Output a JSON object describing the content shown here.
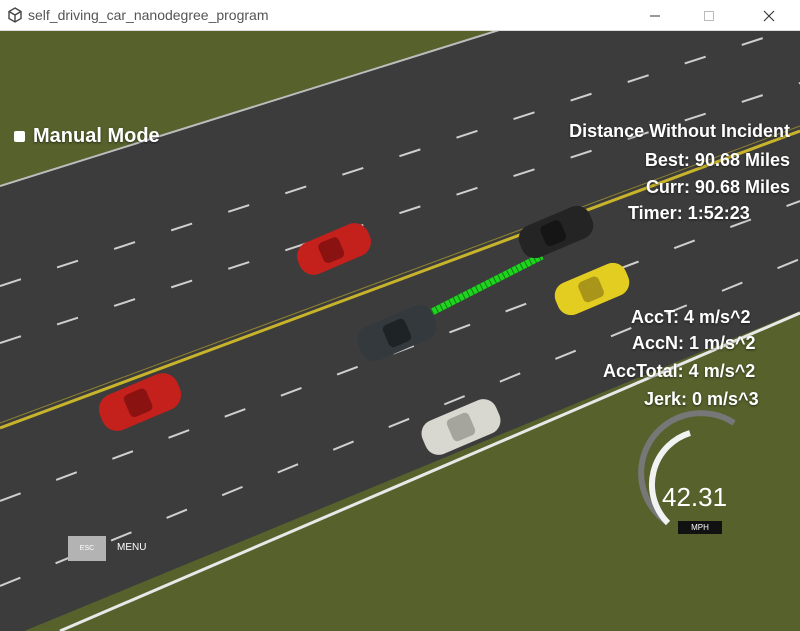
{
  "window": {
    "title": "self_driving_car_nanodegree_program",
    "min_icon": "minimize-icon",
    "max_icon": "maximize-icon",
    "close_icon": "close-icon"
  },
  "hud": {
    "manual_mode_label": "Manual Mode",
    "distance_title": "Distance Without Incident",
    "best": "Best: 90.68 Miles",
    "curr": "Curr: 90.68 Miles",
    "timer": "Timer: 1:52:23",
    "acc_t": "AccT: 4 m/s^2",
    "acc_n": "AccN: 1 m/s^2",
    "acc_total": "AccTotal: 4 m/s^2",
    "jerk": "Jerk: 0 m/s^3"
  },
  "speedometer": {
    "value": "42.31",
    "unit": "MPH"
  },
  "menu": {
    "esc_label": "ESC",
    "menu_label": "MENU"
  },
  "colors": {
    "grass": "#4f5a2a",
    "road": "#3b3b3b",
    "lane_yellow": "#c9b52a",
    "path_green": "#1fd41f",
    "car_red": "#c4201c",
    "car_yellow": "#e0cb1f",
    "car_black": "#2a2a2a",
    "car_white": "#d8d8d0",
    "ego_car": "#33393d"
  }
}
